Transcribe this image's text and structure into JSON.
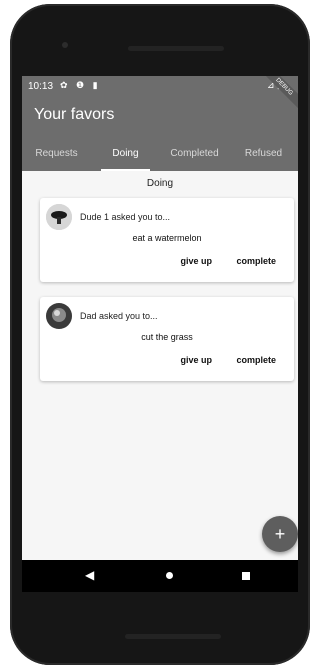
{
  "status": {
    "time": "10:13",
    "icons_left": "✿ ❶ ▮",
    "icons_right": "⊿ ▮"
  },
  "debug_ribbon": "DEBUG",
  "appbar": {
    "title": "Your favors"
  },
  "tabs": [
    {
      "label": "Requests"
    },
    {
      "label": "Doing"
    },
    {
      "label": "Completed"
    },
    {
      "label": "Refused"
    }
  ],
  "main": {
    "section_title": "Doing",
    "cards": [
      {
        "who": "Dude 1 asked you to...",
        "task": "eat a watermelon",
        "give_up": "give up",
        "complete": "complete"
      },
      {
        "who": "Dad asked you to...",
        "task": "cut the grass",
        "give_up": "give up",
        "complete": "complete"
      }
    ]
  },
  "fab": {
    "label": "+"
  },
  "nav": {
    "back": "◀"
  }
}
